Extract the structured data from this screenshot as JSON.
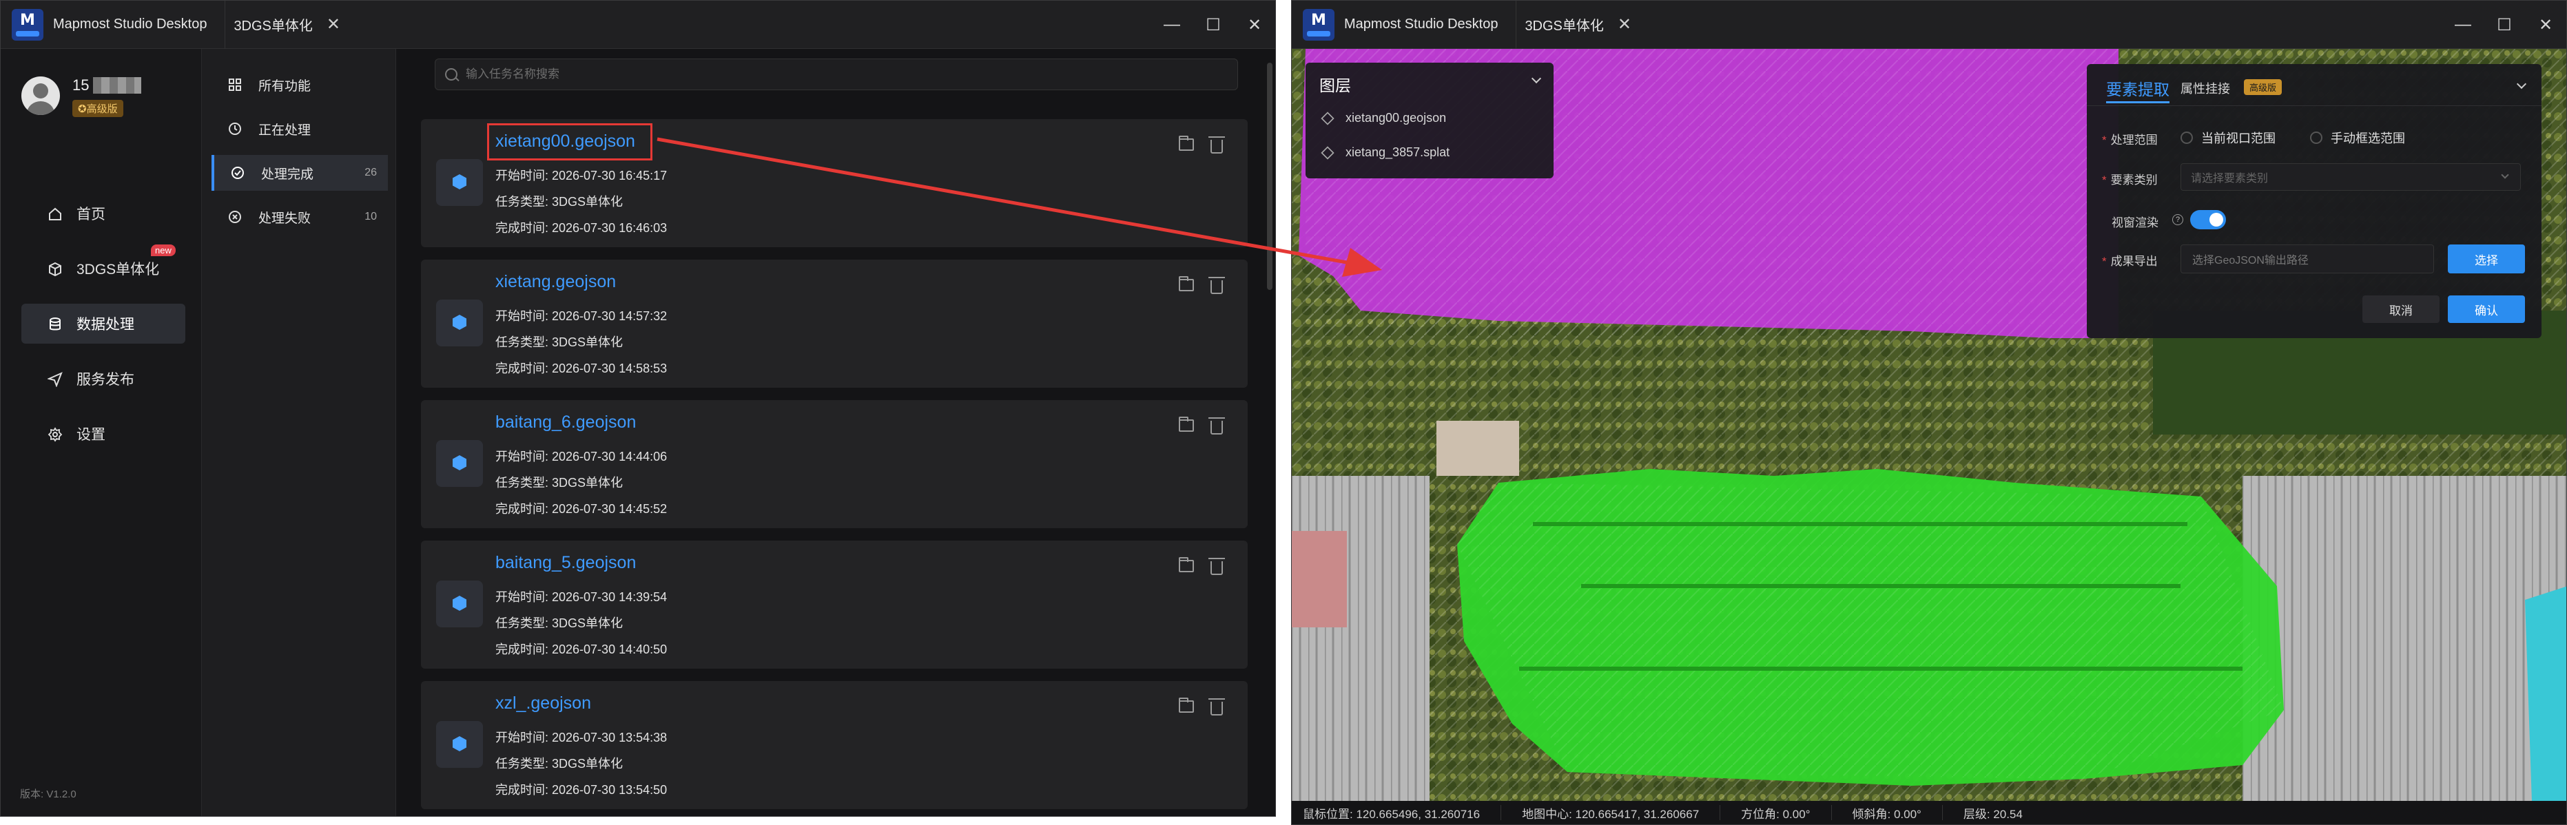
{
  "left_window": {
    "app_title": "Mapmost Studio Desktop",
    "tab_label": "3DGS单体化",
    "tab_close": "✕",
    "controls": {
      "minimize": "—",
      "maximize": "☐",
      "close": "✕"
    },
    "user": {
      "name_prefix": "15",
      "badge": "✪高级版"
    },
    "nav": [
      {
        "label": "首页",
        "icon": "home-icon"
      },
      {
        "label": "3DGS单体化",
        "icon": "cube-icon",
        "badge": "new"
      },
      {
        "label": "数据处理",
        "icon": "database-icon",
        "active": true
      },
      {
        "label": "服务发布",
        "icon": "send-icon"
      },
      {
        "label": "设置",
        "icon": "gear-icon"
      }
    ],
    "version": "版本: V1.2.0",
    "filters": [
      {
        "label": "所有功能",
        "count": ""
      },
      {
        "label": "正在处理",
        "count": ""
      },
      {
        "label": "处理完成",
        "count": "26",
        "active": true
      },
      {
        "label": "处理失败",
        "count": "10"
      }
    ],
    "search_placeholder": "输入任务名称搜索",
    "tasks": [
      {
        "name": "xietang00.geojson",
        "start": "开始时间: 2026-07-30 16:45:17",
        "type": "任务类型: 3DGS单体化",
        "end": "完成时间: 2026-07-30 16:46:03"
      },
      {
        "name": "xietang.geojson",
        "start": "开始时间: 2026-07-30 14:57:32",
        "type": "任务类型: 3DGS单体化",
        "end": "完成时间: 2026-07-30 14:58:53"
      },
      {
        "name": "baitang_6.geojson",
        "start": "开始时间: 2026-07-30 14:44:06",
        "type": "任务类型: 3DGS单体化",
        "end": "完成时间: 2026-07-30 14:45:52"
      },
      {
        "name": "baitang_5.geojson",
        "start": "开始时间: 2026-07-30 14:39:54",
        "type": "任务类型: 3DGS单体化",
        "end": "完成时间: 2026-07-30 14:40:50"
      },
      {
        "name": "xzl_.geojson",
        "start": "开始时间: 2026-07-30 13:54:38",
        "type": "任务类型: 3DGS单体化",
        "end": "完成时间: 2026-07-30 13:54:50"
      }
    ]
  },
  "right_window": {
    "app_title": "Mapmost Studio Desktop",
    "tab_label": "3DGS单体化",
    "tab_close": "✕",
    "controls": {
      "minimize": "—",
      "maximize": "☐",
      "close": "✕"
    },
    "layers": {
      "title": "图层",
      "items": [
        "xietang00.geojson",
        "xietang_3857.splat"
      ]
    },
    "feature_panel": {
      "tab_active": "要素提取",
      "tab_other": "属性挂接",
      "badge": "高级版",
      "range_label": "处理范围",
      "range_opt1": "当前视口范围",
      "range_opt2": "手动框选范围",
      "category_label": "要素类别",
      "category_placeholder": "请选择要素类别",
      "viewport_label": "视窗渲染",
      "viewport_enabled": true,
      "export_label": "成果导出",
      "export_placeholder": "选择GeoJSON输出路径",
      "choose_btn": "选择",
      "cancel_btn": "取消",
      "confirm_btn": "确认"
    },
    "status": {
      "cursor": "鼠标位置: 120.665496, 31.260716",
      "center": "地图中心: 120.665417, 31.260667",
      "bearing": "方位角: 0.00°",
      "pitch": "倾斜角: 0.00°",
      "zoom": "层级: 20.54"
    },
    "colors": {
      "purple_feature": "#c03ad8",
      "green_feature": "#2fd62b",
      "accent": "#2b8df0"
    }
  }
}
